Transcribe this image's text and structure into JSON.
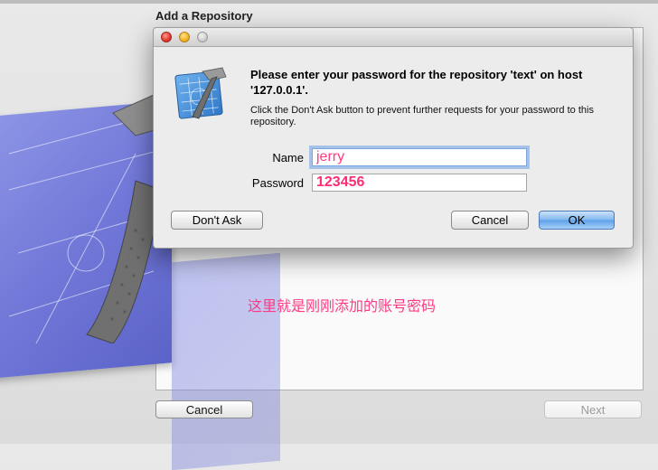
{
  "sheet": {
    "title": "Add a Repository",
    "cancel_label": "Cancel",
    "next_label": "Next"
  },
  "dialog": {
    "title": "Please enter your password for the repository 'text' on host '127.0.0.1'.",
    "subtitle": "Click the Don't Ask button to prevent further requests for your password to this repository.",
    "name_label": "Name",
    "name_value": "jerry",
    "password_label": "Password",
    "password_value": "123456",
    "dont_ask_label": "Don't Ask",
    "cancel_label": "Cancel",
    "ok_label": "OK"
  },
  "annotation": "这里就是刚刚添加的账号密码",
  "colors": {
    "annotation": "#ff3a84",
    "primary_button": "#5d9fe8",
    "focus_ring": "#7aa7e0"
  },
  "icons": [
    "hammer-blueprint-icon",
    "close-icon",
    "minimize-icon",
    "zoom-icon",
    "xcode-app-icon"
  ]
}
